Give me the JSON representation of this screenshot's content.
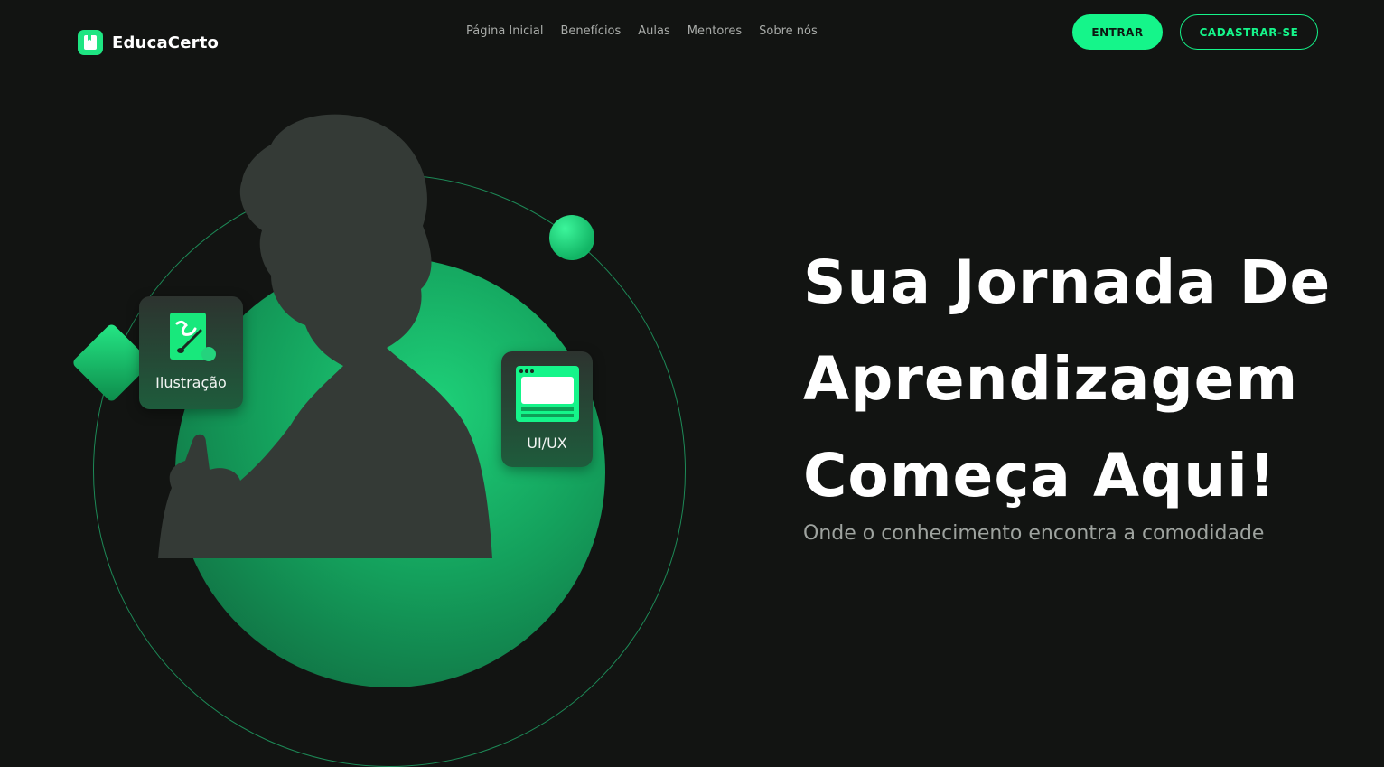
{
  "brand": {
    "name": "EducaCerto",
    "logo_icon": "book-icon",
    "accent": "#15F58A"
  },
  "nav": {
    "items": [
      "Página Inicial",
      "Benefícios",
      "Aulas",
      "Mentores",
      "Sobre nós"
    ]
  },
  "actions": {
    "login_label": "ENTRAR",
    "signup_label": "CADASTRAR-SE"
  },
  "hero": {
    "title_lines": [
      "Sua Jornada De",
      "Aprendizagem",
      "Começa Aqui!"
    ],
    "subtitle": "Onde o conhecimento encontra a comodidade"
  },
  "badges": [
    {
      "label": "Ilustração",
      "icon": "illustration-icon"
    },
    {
      "label": "UI/UX",
      "icon": "browser-window-icon"
    }
  ],
  "colors": {
    "background": "#121412",
    "accent": "#15F58A",
    "muted_text": "#A9ACA9"
  }
}
